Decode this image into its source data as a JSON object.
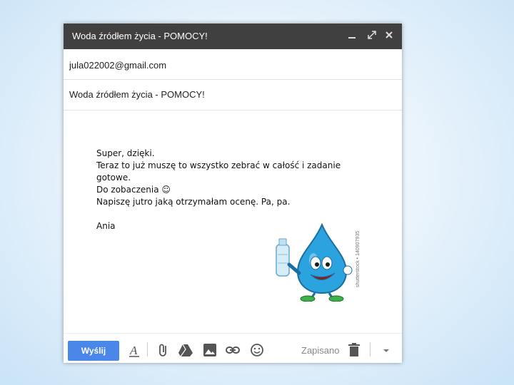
{
  "window": {
    "title": "Woda źródłem życia - POMOCY!",
    "controls": [
      "minimize-icon",
      "expand-icon",
      "close-icon"
    ]
  },
  "fields": {
    "to": "jula022002@gmail.com",
    "subject": "Woda źródłem życia - POMOCY!"
  },
  "message": {
    "lines": [
      "Super, dzięki.",
      "Teraz to już muszę to wszystko zebrać w całość i zadanie gotowe.",
      "Do zobaczenia ☺",
      "Napiszę jutro jaką otrzymałam ocenę. Pa, pa.",
      "",
      "Ania"
    ]
  },
  "image": {
    "watermark": "shutterstock • 140907935",
    "description_icon": "water-drop-mascot"
  },
  "toolbar": {
    "send_label": "Wyślij",
    "saved_label": "Zapisano",
    "icons": [
      "format-text-icon",
      "attach-icon",
      "drive-icon",
      "photo-icon",
      "link-icon",
      "emoji-icon",
      "trash-icon",
      "more-options-icon"
    ]
  },
  "colors": {
    "titlebar": "#404040",
    "send": "#4a87e8"
  }
}
